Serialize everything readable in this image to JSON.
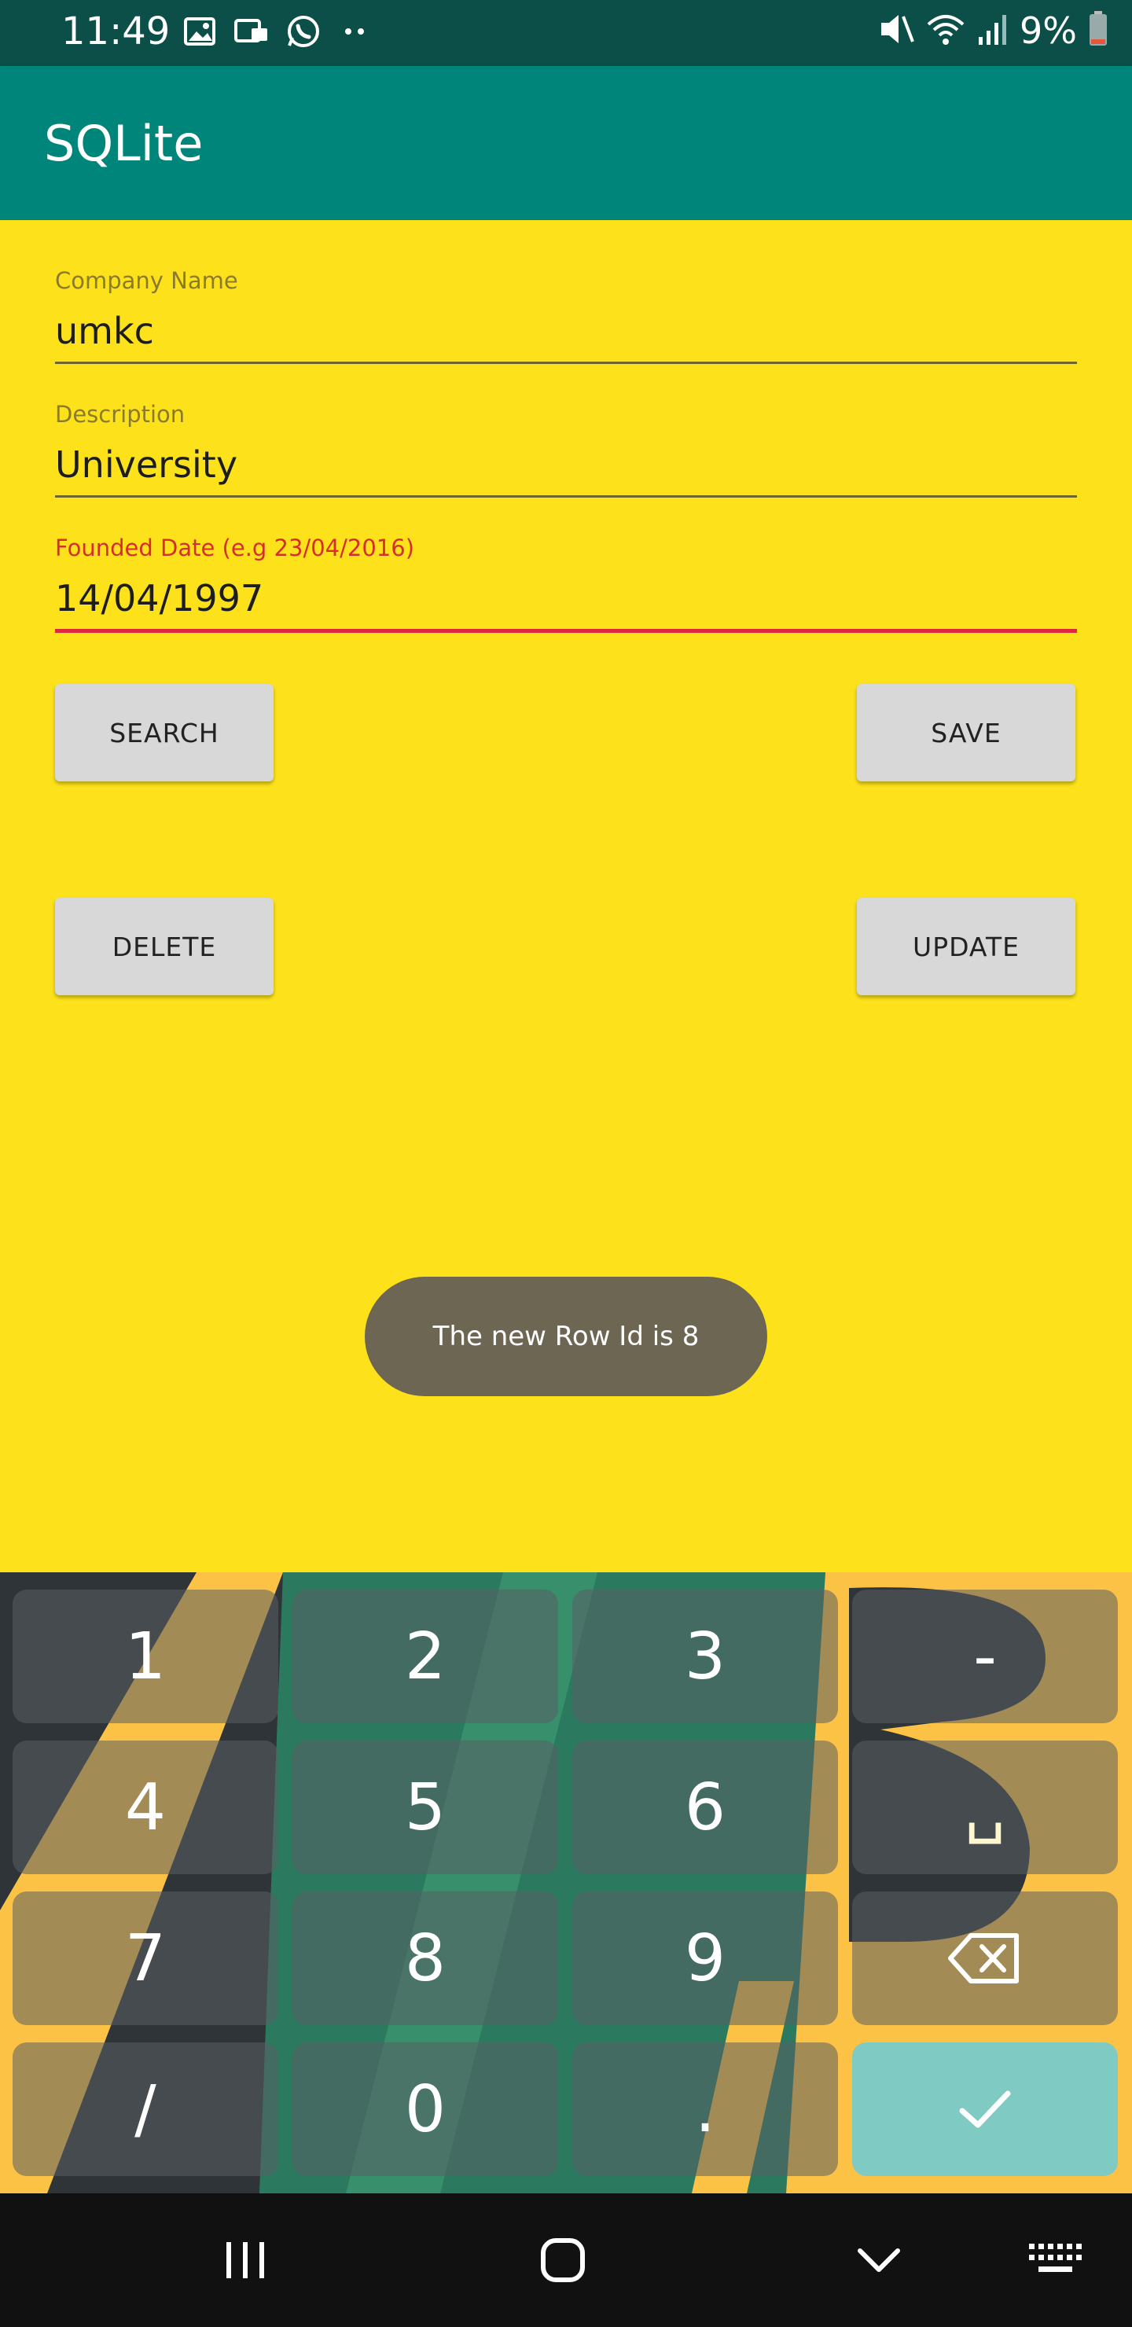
{
  "status_bar": {
    "time": "11:49",
    "battery": "9%",
    "icons": [
      "image-icon",
      "voicemail-icon",
      "whatsapp-icon",
      "more-dots-icon",
      "mute-icon",
      "wifi-icon",
      "signal-icon",
      "battery-icon"
    ]
  },
  "app_bar": {
    "title": "SQLite"
  },
  "form": {
    "company": {
      "label": "Company Name",
      "value": "umkc"
    },
    "description": {
      "label": "Description",
      "value": "University"
    },
    "founded": {
      "label": "Founded Date (e.g 23/04/2016)",
      "value": "14/04/1997"
    }
  },
  "buttons": {
    "search": "SEARCH",
    "save": "SAVE",
    "delete": "DELETE",
    "update": "UPDATE"
  },
  "toast": {
    "message": "The new Row Id is 8"
  },
  "keyboard": {
    "keys": [
      "1",
      "2",
      "3",
      "-",
      "4",
      "5",
      "6",
      "␣",
      "7",
      "8",
      "9",
      "backspace",
      "/",
      "0",
      ".",
      "done"
    ]
  },
  "colors": {
    "status_bar": "#0b4f48",
    "app_bar": "#00857a",
    "background": "#fde21b",
    "error": "#e0283c",
    "enter_key": "#7fcac3"
  }
}
